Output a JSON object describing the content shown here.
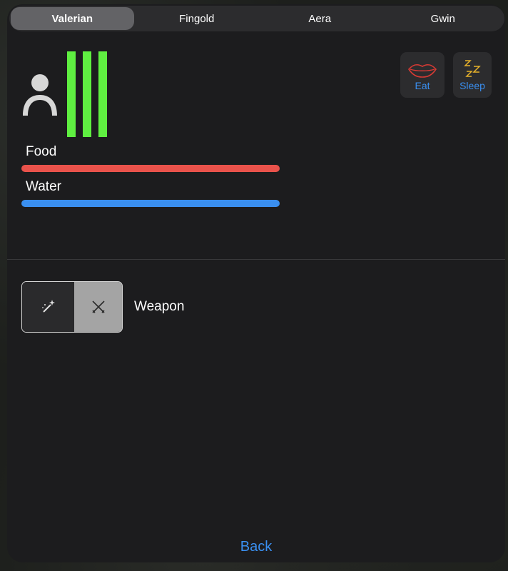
{
  "tabs": [
    {
      "label": "Valerian",
      "selected": true
    },
    {
      "label": "Fingold",
      "selected": false
    },
    {
      "label": "Aera",
      "selected": false
    },
    {
      "label": "Gwin",
      "selected": false
    }
  ],
  "character": {
    "avatar_icon": "person-icon",
    "health_bar_color": "#5fef41",
    "health_bars_count_shown": "3"
  },
  "stats": {
    "food": {
      "label": "Food",
      "color": "#e9524b",
      "fraction": 1.0
    },
    "water": {
      "label": "Water",
      "color": "#3a8ff0",
      "fraction": 1.0
    }
  },
  "actions": {
    "eat": {
      "label": "Eat",
      "icon": "lips-icon"
    },
    "sleep": {
      "label": "Sleep",
      "icon": "zzz-icon"
    }
  },
  "weapon": {
    "label": "Weapon",
    "options": [
      {
        "icon": "magic-wand-icon",
        "selected": false
      },
      {
        "icon": "crossed-swords-icon",
        "selected": true
      }
    ]
  },
  "footer": {
    "back_label": "Back"
  },
  "colors": {
    "accent": "#3a8ff0",
    "panel": "#1c1c1e"
  }
}
